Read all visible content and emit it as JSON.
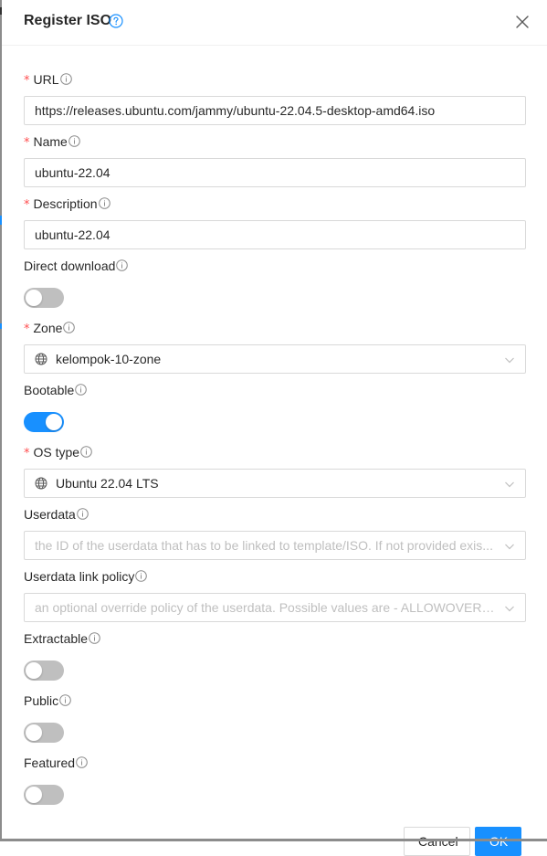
{
  "modal": {
    "title": "Register ISO",
    "help_icon": "question-circle-icon",
    "close_icon": "close-icon"
  },
  "colors": {
    "primary": "#1890ff",
    "required": "#ff4d4f",
    "switch_off": "#bfbfbf",
    "border": "#d9d9d9",
    "placeholder": "#bfbfbf"
  },
  "form": {
    "url": {
      "label": "URL",
      "required": "*",
      "value": "https://releases.ubuntu.com/jammy/ubuntu-22.04.5-desktop-amd64.iso"
    },
    "name": {
      "label": "Name",
      "required": "*",
      "value": "ubuntu-22.04"
    },
    "description": {
      "label": "Description",
      "required": "*",
      "value": "ubuntu-22.04"
    },
    "direct_download": {
      "label": "Direct download",
      "checked": false
    },
    "zone": {
      "label": "Zone",
      "required": "*",
      "value": "kelompok-10-zone",
      "icon": "globe-icon"
    },
    "bootable": {
      "label": "Bootable",
      "checked": true
    },
    "os_type": {
      "label": "OS type",
      "required": "*",
      "value": "Ubuntu 22.04 LTS",
      "icon": "globe-icon"
    },
    "userdata": {
      "label": "Userdata",
      "placeholder": "the ID of the userdata that has to be linked to template/ISO. If not provided exis..."
    },
    "userdata_link_policy": {
      "label": "Userdata link policy",
      "placeholder": "an optional override policy of the userdata. Possible values are - ALLOWOVERRI..."
    },
    "extractable": {
      "label": "Extractable",
      "checked": false
    },
    "public": {
      "label": "Public",
      "checked": false
    },
    "featured": {
      "label": "Featured",
      "checked": false
    }
  },
  "footer": {
    "cancel_label": "Cancel",
    "ok_label": "OK"
  }
}
